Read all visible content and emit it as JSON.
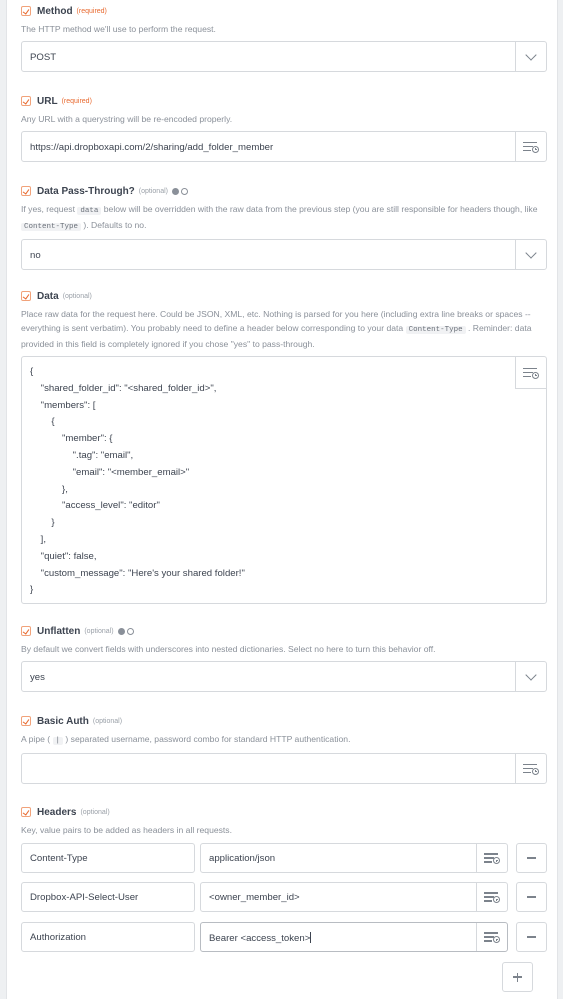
{
  "method": {
    "label": "Method",
    "badge": "(required)",
    "help": "The HTTP method we'll use to perform the request.",
    "value": "POST"
  },
  "url": {
    "label": "URL",
    "badge": "(required)",
    "help": "Any URL with a querystring will be re-encoded properly.",
    "value": "https://api.dropboxapi.com/2/sharing/add_folder_member"
  },
  "passthrough": {
    "label": "Data Pass-Through?",
    "badge": "(optional)",
    "help_1": "If yes, request ",
    "help_code_1": "data",
    "help_2": " below will be overridden with the raw data from the previous step (you are still responsible for headers though, like ",
    "help_code_2": "Content-Type",
    "help_3": " ). Defaults to no.",
    "value": "no"
  },
  "data": {
    "label": "Data",
    "badge": "(optional)",
    "help_1": "Place raw data for the request here. Could be JSON, XML, etc. Nothing is parsed for you here (including extra line breaks or spaces -- everything is sent verbatim). You probably need to define a header below corresponding to your data ",
    "help_code": "Content-Type",
    "help_2": " . Reminder: data provided in this field is completely ignored if you chose \"yes\" to pass-through.",
    "value": "{\n    \"shared_folder_id\": \"<shared_folder_id>\",\n    \"members\": [\n        {\n            \"member\": {\n                \".tag\": \"email\",\n                \"email\": \"<member_email>\"\n            },\n            \"access_level\": \"editor\"\n        }\n    ],\n    \"quiet\": false,\n    \"custom_message\": \"Here's your shared folder!\"\n}"
  },
  "unflatten": {
    "label": "Unflatten",
    "badge": "(optional)",
    "help": "By default we convert fields with underscores into nested dictionaries. Select no here to turn this behavior off.",
    "value": "yes"
  },
  "basic_auth": {
    "label": "Basic Auth",
    "badge": "(optional)",
    "help_1": "A pipe ( ",
    "help_code": "|",
    "help_2": " ) separated username, password combo for standard HTTP authentication.",
    "value": ""
  },
  "headers": {
    "label": "Headers",
    "badge": "(optional)",
    "help": "Key, value pairs to be added as headers in all requests.",
    "rows": [
      {
        "key": "Content-Type",
        "value": "application/json"
      },
      {
        "key": "Dropbox-API-Select-User",
        "value": "<owner_member_id>"
      },
      {
        "key": "Authorization",
        "value": "Bearer <access_token>"
      }
    ]
  },
  "icons": {
    "field": "field-icon",
    "dropdown": "chevron-down-icon",
    "insert": "insert-data-icon",
    "remove": "minus-icon",
    "add": "plus-icon",
    "toggle": "toggle-dots-icon"
  },
  "colors": {
    "required": "#e8692f",
    "optional": "#9aa0a8",
    "border": "#d6d9dd"
  }
}
